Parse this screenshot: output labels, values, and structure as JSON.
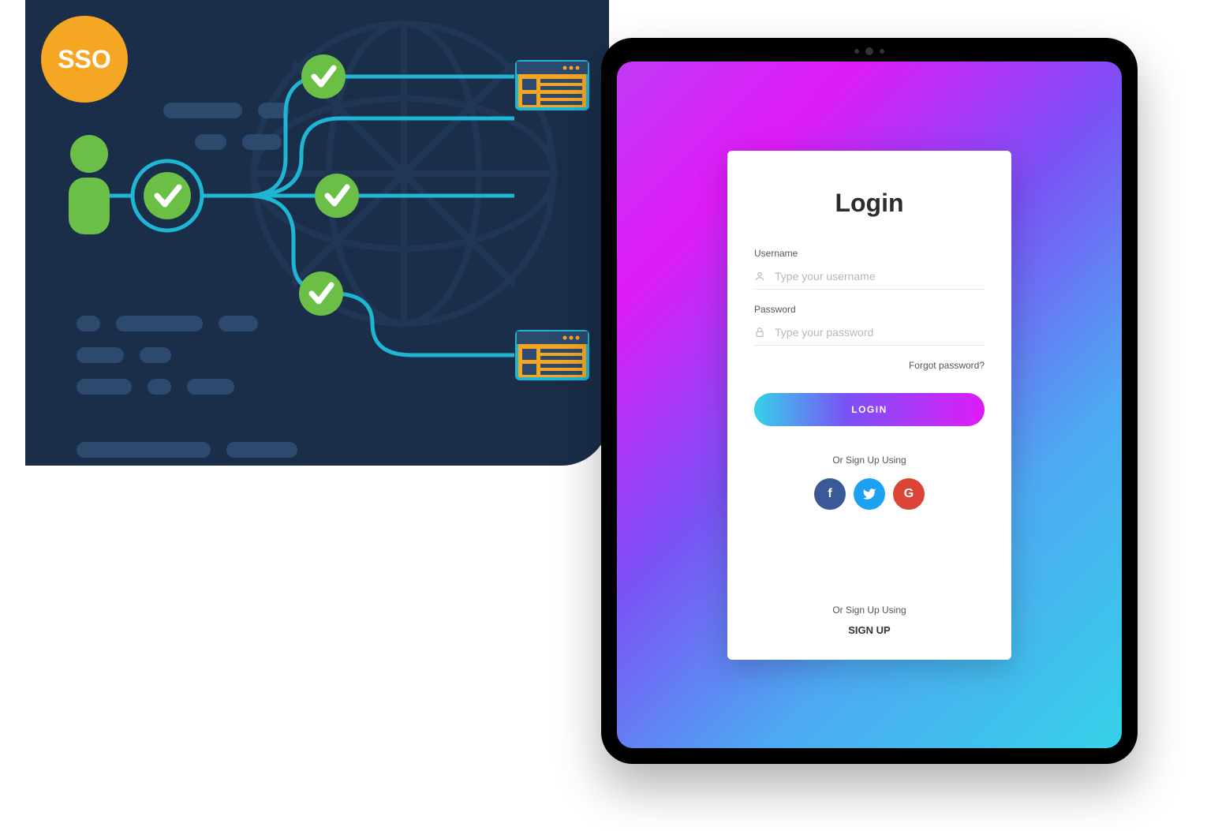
{
  "sso": {
    "badge_label": "SSO"
  },
  "login": {
    "title": "Login",
    "username_label": "Username",
    "username_placeholder": "Type your username",
    "password_label": "Password",
    "password_placeholder": "Type your password",
    "forgot_text": "Forgot password?",
    "login_button": "LOGIN",
    "or_signup_social": "Or Sign Up Using",
    "or_signup_bottom": "Or Sign Up Using",
    "signup_link": "SIGN UP",
    "social": {
      "facebook": "f",
      "twitter": "t",
      "google": "G"
    }
  },
  "colors": {
    "sso_badge": "#f5a623",
    "sso_bg": "#1a2e4a",
    "check_green": "#6bbf47",
    "line_cyan": "#1fb6d4",
    "gradient_start": "#36d1e8",
    "gradient_mid": "#7b52f5",
    "gradient_end": "#de1cf7"
  }
}
